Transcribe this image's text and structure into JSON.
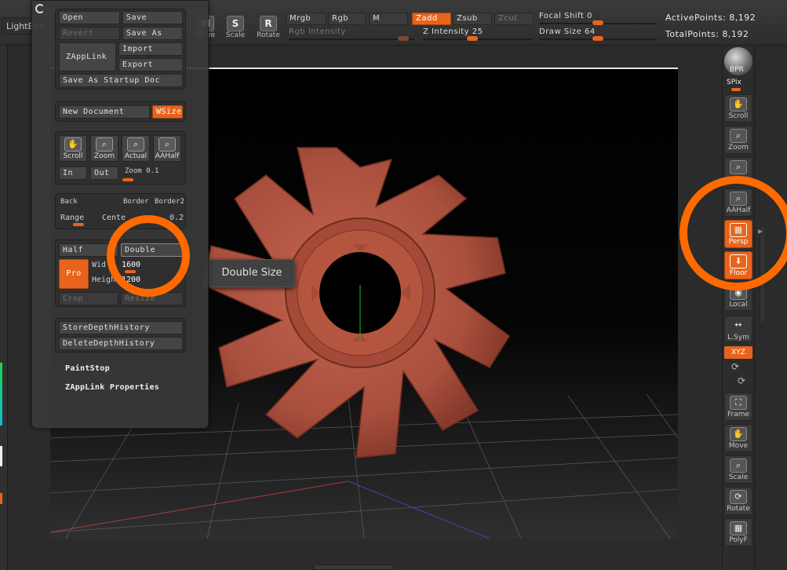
{
  "topbar": {
    "lightbox": "LightBox",
    "transform": {
      "move": "Move",
      "scale": "Scale",
      "rotate": "Rotate",
      "move_glyph": "M",
      "scale_glyph": "S",
      "rotate_glyph": "R"
    },
    "mrgb": "Mrgb",
    "rgb": "Rgb",
    "m": "M",
    "zadd": "Zadd",
    "zsub": "Zsub",
    "zcut": "Zcut",
    "rgb_intensity": "Rgb Intensity",
    "z_intensity_label": "Z Intensity",
    "z_intensity_value": "25",
    "focal_shift_label": "Focal Shift",
    "focal_shift_value": "0",
    "draw_size_label": "Draw Size",
    "draw_size_value": "64",
    "active_points": "ActivePoints: 8,192",
    "total_points": "TotalPoints: 8,192"
  },
  "menu": {
    "open": "Open",
    "save": "Save",
    "revert": "Revert",
    "save_as": "Save As",
    "zapplink": "ZAppLink",
    "import": "Import",
    "export": "Export",
    "save_startup": "Save As Startup Doc",
    "new_document": "New Document",
    "wsize": "WSize",
    "scroll": "Scroll",
    "zoom": "Zoom",
    "actual": "Actual",
    "aahalf": "AAHalf",
    "in": "In",
    "out": "Out",
    "zoom_label": "Zoom",
    "zoom_value": "0.1",
    "back": "Back",
    "border": "Border",
    "border2": "Border2",
    "range": "Range",
    "center": "Cente",
    "center_value": "0.2",
    "half": "Half",
    "double": "Double",
    "pro": "Pro",
    "width_label": "Wid",
    "width_value": "1600",
    "height_label": "Heigh",
    "height_value": "1200",
    "crop": "Crop",
    "resize": "Resize",
    "store_depth": "StoreDepthHistory",
    "delete_depth": "DeleteDepthHistory",
    "paintstop": "PaintStop",
    "zapplink_props": "ZAppLink Properties"
  },
  "tooltip": "Double Size",
  "right_shelf": {
    "bpr": "BPR",
    "spix": "SPix",
    "scroll": "Scroll",
    "zoom": "Zoom",
    "aahalf": "AAHalf",
    "persp": "Persp",
    "floor": "Floor",
    "local": "Local",
    "lsym": "L.Sym",
    "xyz": "XYZ",
    "frame": "Frame",
    "move": "Move",
    "scale": "Scale",
    "rotate": "Rotate",
    "polyf": "PolyF"
  },
  "colors": {
    "accent": "#e8641c",
    "highlight_circle": "#ff6a00",
    "model": "#b55a45"
  }
}
